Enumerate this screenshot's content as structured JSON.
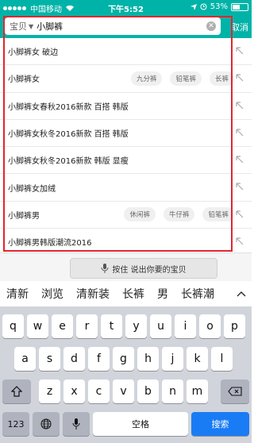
{
  "status": {
    "carrier": "中国移动",
    "time": "下午5:52",
    "battery": "53%",
    "alarm_icon": "alarm-icon",
    "battery_level": 0.53
  },
  "search": {
    "scope": "宝贝",
    "query": "小脚裤",
    "cancel": "取消"
  },
  "suggestions": [
    {
      "text": "小脚裤女 破边",
      "tags": []
    },
    {
      "text": "小脚裤女",
      "tags": [
        "九分裤",
        "铅笔裤",
        "长裤"
      ]
    },
    {
      "text": "小脚裤女春秋2016新款 百搭 韩版",
      "tags": []
    },
    {
      "text": "小脚裤女秋冬2016新款 百搭 韩版",
      "tags": []
    },
    {
      "text": "小脚裤女秋冬2016新款 韩版 显瘦",
      "tags": []
    },
    {
      "text": "小脚裤女加绒",
      "tags": []
    },
    {
      "text": "小脚裤男",
      "tags": [
        "休闲裤",
        "牛仔裤",
        "铅笔裤"
      ]
    },
    {
      "text": "小脚裤男韩版潮流2016",
      "tags": []
    }
  ],
  "voice": {
    "label": "按住 说出你要的宝贝"
  },
  "candidates": [
    "清新",
    "浏览",
    "清新装",
    "长裤",
    "男",
    "长裤潮"
  ],
  "keyboard": {
    "row1": [
      "q",
      "w",
      "e",
      "r",
      "t",
      "y",
      "u",
      "i",
      "o",
      "p"
    ],
    "row2": [
      "a",
      "s",
      "d",
      "f",
      "g",
      "h",
      "j",
      "k",
      "l"
    ],
    "row3": [
      "z",
      "x",
      "c",
      "v",
      "b",
      "n",
      "m"
    ],
    "num": "123",
    "space": "空格",
    "search": "搜索"
  },
  "colors": {
    "accent": "#00b3a8",
    "highlight": "#e0262e",
    "search_key": "#1a7cf5"
  }
}
